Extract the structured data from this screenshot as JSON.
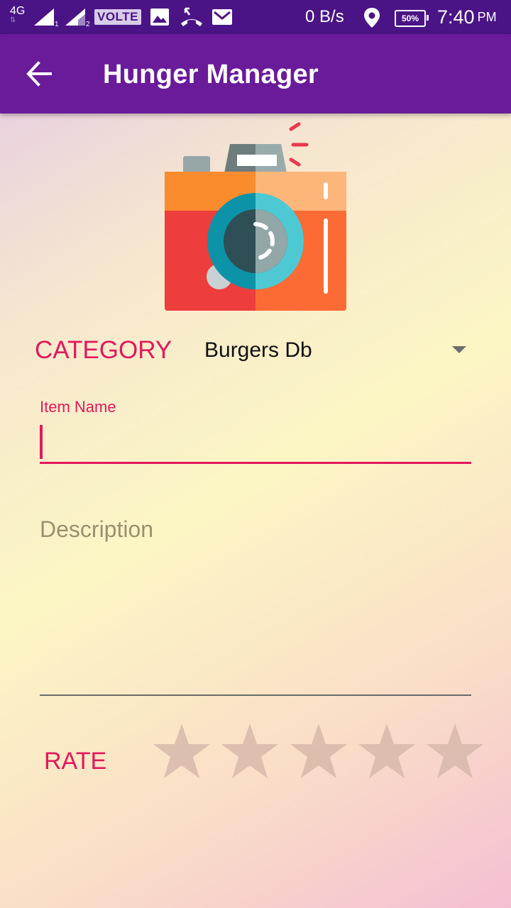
{
  "status_bar": {
    "network": "4G",
    "sim1": "1",
    "sim2": "2",
    "volte": "VOLTE",
    "speed": "0 B/s",
    "battery": "50%",
    "time": "7:40",
    "ampm": "PM"
  },
  "app_bar": {
    "title": "Hunger Manager",
    "back_icon": "arrow-back-icon"
  },
  "photo": {
    "icon": "camera-icon"
  },
  "category": {
    "label": "CATEGORY",
    "selected": "Burgers Db"
  },
  "item_name": {
    "label": "Item Name",
    "value": ""
  },
  "description": {
    "placeholder": "Description",
    "value": ""
  },
  "rating": {
    "label": "RATE",
    "value": 0,
    "max": 5
  },
  "colors": {
    "status_bar": "#4a1486",
    "app_bar": "#6a1b9a",
    "accent": "#e0195d",
    "star_empty": "#d4b7a9"
  }
}
